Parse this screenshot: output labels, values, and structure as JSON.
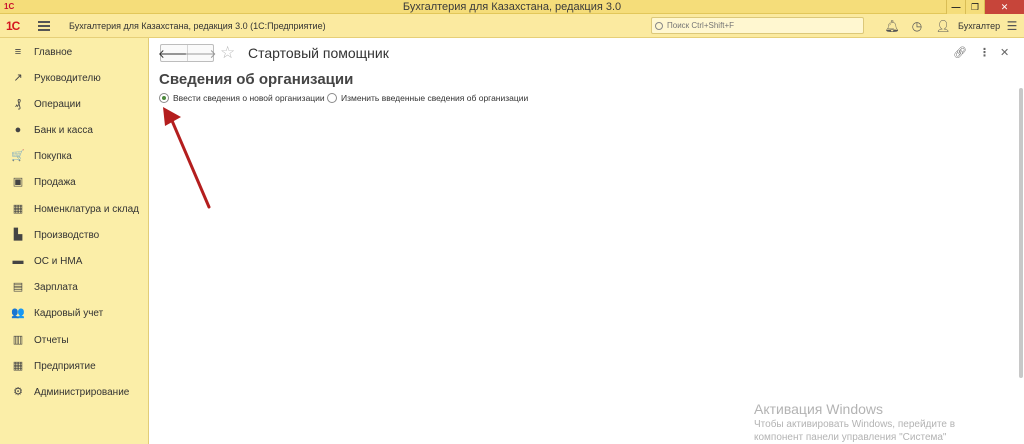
{
  "window": {
    "title": "Бухгалтерия для Казахстана, редакция 3.0",
    "controls": [
      "minimize",
      "restore",
      "close"
    ]
  },
  "header": {
    "logo": "1С",
    "app_title": "Бухгалтерия для Казахстана, редакция 3.0 (1С:Предприятие)",
    "search_placeholder": "Поиск Ctrl+Shift+F",
    "user": "Бухгалтер",
    "icons": [
      "bell-icon",
      "history-icon",
      "settings-menu-icon"
    ]
  },
  "sidebar": {
    "items": [
      {
        "label": "Главное",
        "icon": "≡"
      },
      {
        "label": "Руководителю",
        "icon": "↗"
      },
      {
        "label": "Операции",
        "icon": "₰"
      },
      {
        "label": "Банк и касса",
        "icon": "●"
      },
      {
        "label": "Покупка",
        "icon": "🛒"
      },
      {
        "label": "Продажа",
        "icon": "▣"
      },
      {
        "label": "Номенклатура и склад",
        "icon": "▦"
      },
      {
        "label": "Производство",
        "icon": "▙"
      },
      {
        "label": "ОС и НМА",
        "icon": "▬"
      },
      {
        "label": "Зарплата",
        "icon": "▤"
      },
      {
        "label": "Кадровый учет",
        "icon": "👥"
      },
      {
        "label": "Отчеты",
        "icon": "▥"
      },
      {
        "label": "Предприятие",
        "icon": "▦"
      },
      {
        "label": "Администрирование",
        "icon": "⚙"
      }
    ]
  },
  "page": {
    "title": "Стартовый помощник",
    "section_title": "Сведения об организации",
    "options": [
      {
        "label": "Ввести сведения о новой организации",
        "checked": true
      },
      {
        "label": "Изменить введенные сведения об организации",
        "checked": false
      }
    ]
  },
  "watermark": {
    "line1": "Активация Windows",
    "line2": "Чтобы активировать Windows, перейдите в",
    "line3": "компонент панели управления \"Система\""
  },
  "colors": {
    "titlebar": "#f5dd7a",
    "sidebar": "#fbeea8",
    "arrow": "#b41e1e",
    "radio_checked": "#4d8a3e"
  }
}
